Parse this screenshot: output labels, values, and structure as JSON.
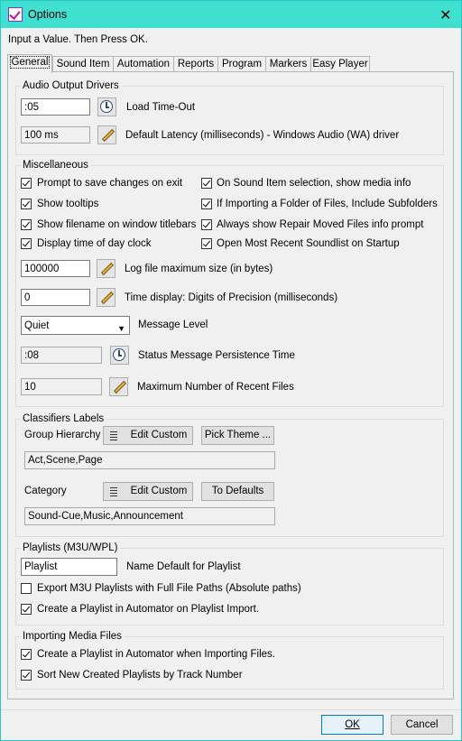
{
  "window": {
    "title": "Options",
    "close_icon": "close-icon"
  },
  "instruction": "Input a Value. Then Press OK.",
  "tabs": [
    "General",
    "Sound Item",
    "Automation",
    "Reports",
    "Program",
    "Markers",
    "Easy Player"
  ],
  "audio": {
    "group_title": "Audio Output Drivers",
    "load_timeout_value": ":05",
    "load_timeout_label": "Load Time-Out",
    "latency_value": "100 ms",
    "latency_label": "Default Latency (milliseconds) - Windows Audio (WA) driver"
  },
  "misc": {
    "group_title": "Miscellaneous",
    "checks": [
      {
        "label": "Prompt to save changes on exit",
        "checked": true
      },
      {
        "label": "On Sound Item selection, show media info",
        "checked": true
      },
      {
        "label": "Show tooltips",
        "checked": true
      },
      {
        "label": "If Importing a Folder of Files, Include Subfolders",
        "checked": true
      },
      {
        "label": "Show filename on window titlebars",
        "checked": true
      },
      {
        "label": "Always show Repair Moved Files info prompt",
        "checked": true
      },
      {
        "label": "Display time of day clock",
        "checked": true
      },
      {
        "label": "Open Most Recent Soundlist on Startup",
        "checked": true
      }
    ],
    "log_size_value": "100000",
    "log_size_label": "Log file maximum size (in bytes)",
    "precision_value": "0",
    "precision_label": "Time display: Digits of Precision (milliseconds)",
    "message_level_value": "Quiet",
    "message_level_label": "Message Level",
    "persistence_value": ":08",
    "persistence_label": "Status Message Persistence Time",
    "recent_value": "10",
    "recent_label": "Maximum Number of Recent Files"
  },
  "classifiers": {
    "group_title": "Classifiers Labels",
    "group_hierarchy_label": "Group Hierarchy",
    "edit_custom": "Edit Custom",
    "pick_theme": "Pick Theme ...",
    "hierarchy_value": "Act,Scene,Page",
    "category_label": "Category",
    "to_defaults": "To Defaults",
    "category_value": "Sound-Cue,Music,Announcement"
  },
  "playlists": {
    "group_title": "Playlists (M3U/WPL)",
    "name_value": "Playlist",
    "name_label": "Name Default for Playlist",
    "export_label": "Export M3U Playlists with Full File Paths (Absolute paths)",
    "export_checked": false,
    "create_label": "Create a Playlist in Automator on  Playlist Import.",
    "create_checked": true
  },
  "importing": {
    "group_title": "Importing Media Files",
    "create_label": "Create a Playlist in Automator when Importing Files.",
    "create_checked": true,
    "sort_label": "Sort New Created Playlists by Track Number",
    "sort_checked": true
  },
  "footer": {
    "ok": "OK",
    "cancel": "Cancel"
  }
}
